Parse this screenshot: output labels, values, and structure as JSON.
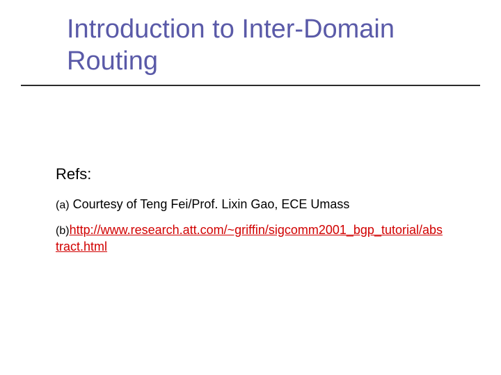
{
  "title": "Introduction to Inter-Domain Routing",
  "refs": {
    "label": "Refs:",
    "items": [
      {
        "marker": "(a)",
        "text": "Courtesy of Teng Fei/Prof. Lixin Gao, ECE Umass",
        "is_link": false
      },
      {
        "marker": "(b)",
        "text": "http://www.research.att.com/~griffin/sigcomm2001_bgp_tutorial/abstract.html",
        "is_link": true
      }
    ]
  },
  "colors": {
    "title": "#5a5aa8",
    "link": "#d10000",
    "rule": "#2a2a2a"
  }
}
